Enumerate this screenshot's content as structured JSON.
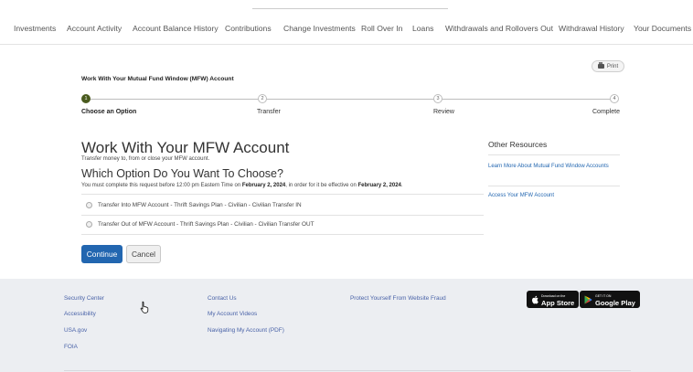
{
  "nav": {
    "items": [
      "Investments",
      "Account Activity",
      "Account Balance History",
      "Contributions",
      "Change Investments",
      "Roll Over In",
      "Loans",
      "Withdrawals and Rollovers Out",
      "Withdrawal History",
      "Your Documents"
    ]
  },
  "print_label": "Print",
  "page_subtitle": "Work With Your Mutual Fund Window (MFW) Account",
  "stepper": {
    "steps": [
      {
        "number": "1",
        "label": "Choose an Option"
      },
      {
        "number": "2",
        "label": "Transfer"
      },
      {
        "number": "3",
        "label": "Review"
      },
      {
        "number": "4",
        "label": "Complete"
      }
    ]
  },
  "main": {
    "heading": "Work With Your MFW Account",
    "heading_sub": "Transfer money to, from or close your MFW account.",
    "question": "Which Option Do You Want To Choose?",
    "notice_part1": "You must complete this request before 12:00 pm Eastern Time on ",
    "notice_date1": "February 2, 2024",
    "notice_part2": ", in order for it be effective on ",
    "notice_date2": "February 2, 2024",
    "notice_part3": ".",
    "options": [
      "Transfer Into MFW Account - Thrift Savings Plan - Civilian - Civilian Transfer IN",
      "Transfer Out of MFW Account - Thrift Savings Plan - Civilian - Civilian Transfer OUT"
    ],
    "continue_label": "Continue",
    "cancel_label": "Cancel"
  },
  "resources": {
    "title": "Other Resources",
    "links": [
      "Learn More About Mutual Fund Window Accounts",
      "Access Your MFW Account"
    ]
  },
  "footer": {
    "col1": [
      "Security Center",
      "Accessibility",
      "USA.gov",
      "FOIA"
    ],
    "col2": [
      "Contact Us",
      "My Account Videos",
      "Navigating My Account (PDF)"
    ],
    "col3": [
      "Protect Yourself From Website Fraud"
    ],
    "app_store": {
      "small": "Download on the",
      "big": "App Store"
    },
    "google_play": {
      "small": "GET IT ON",
      "big": "Google Play"
    }
  },
  "colors": {
    "accent": "#2266b0",
    "step_active": "#4a5b1f",
    "footer_bg": "#eceef2",
    "link": "#4a63a8"
  }
}
